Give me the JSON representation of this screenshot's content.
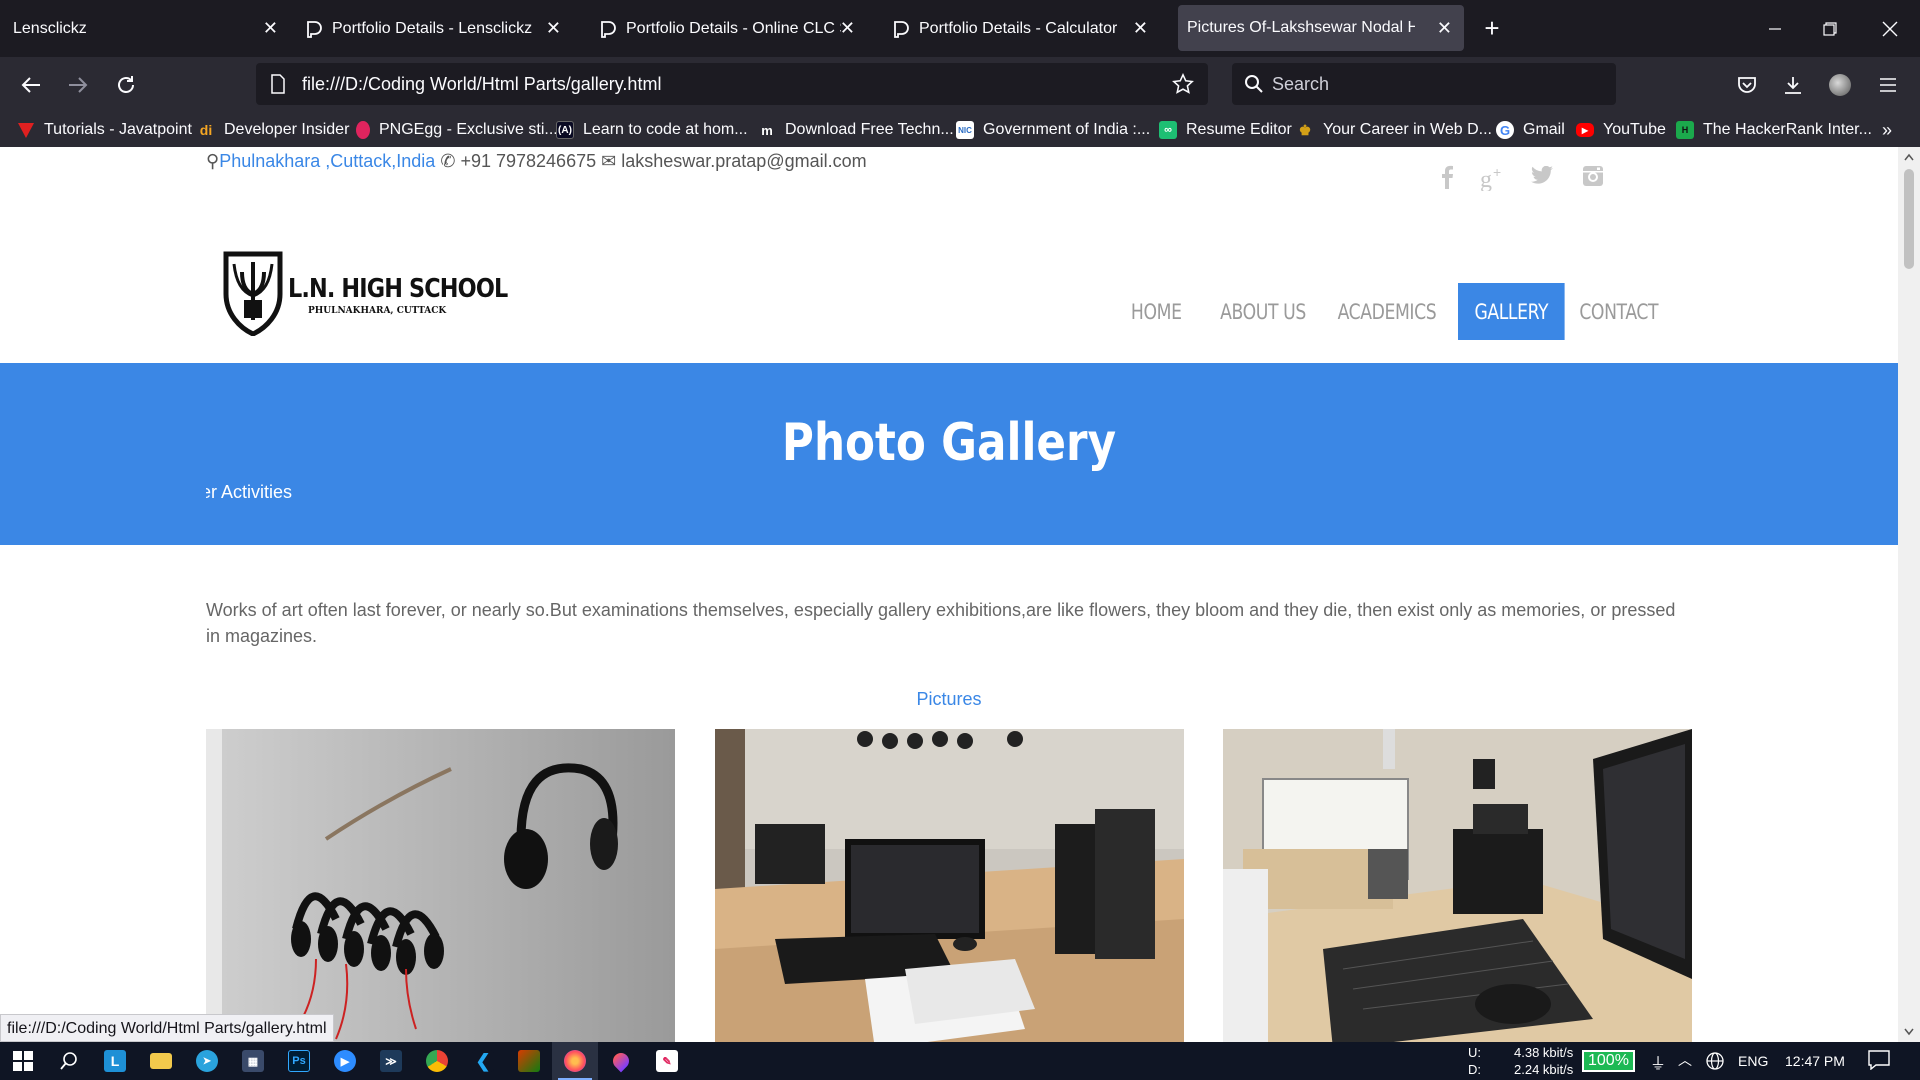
{
  "browser": {
    "tabs": [
      {
        "label": "Lensclickz",
        "active": false
      },
      {
        "label": "Portfolio Details - Lensclickz",
        "active": false
      },
      {
        "label": "Portfolio Details - Online CLC Sys",
        "active": false
      },
      {
        "label": "Portfolio Details - Calculator",
        "active": false
      },
      {
        "label": "Pictures Of-Lakshsewar Nodal High S",
        "active": true
      }
    ],
    "new_tab": "+",
    "url": "file:///D:/Coding World/Html Parts/gallery.html",
    "search_placeholder": "Search",
    "bookmarks": [
      {
        "label": "Tutorials - Javatpoint",
        "icon": "javatpoint-icon",
        "color": "#e02020"
      },
      {
        "label": "Developer Insider",
        "icon": "developer-insider-icon",
        "color": "#f5a623"
      },
      {
        "label": "PNGEgg - Exclusive sti...",
        "icon": "pngegg-icon",
        "color": "#e0245e"
      },
      {
        "label": "Learn to code at hom...",
        "icon": "freecodecamp-icon",
        "color": "#0a0a23"
      },
      {
        "label": "Download Free Techn...",
        "icon": "m-icon",
        "color": "#2b2a33"
      },
      {
        "label": "Government of India :...",
        "icon": "nielit-icon",
        "color": "#2a6cc4"
      },
      {
        "label": "Resume Editor",
        "icon": "resume-editor-icon",
        "color": "#1dbf73"
      },
      {
        "label": "Your Career in Web D...",
        "icon": "career-icon",
        "color": "#d4a017"
      },
      {
        "label": "Gmail",
        "icon": "google-icon",
        "color": "#ffffff"
      },
      {
        "label": "YouTube",
        "icon": "youtube-icon",
        "color": "#ff0000"
      },
      {
        "label": "The HackerRank Inter...",
        "icon": "hackerrank-icon",
        "color": "#111111"
      }
    ]
  },
  "site": {
    "topbar": {
      "location": "Phulnakhara ,Cuttack,India",
      "phone": "+91 7978246675",
      "email": "laksheswar.pratap@gmail.com"
    },
    "logo": {
      "name": "L.N. HIGH SCHOOL",
      "sub": "PHULNAKHARA, CUTTACK"
    },
    "menu": [
      {
        "label": "HOME",
        "active": false
      },
      {
        "label": "ABOUT US",
        "active": false
      },
      {
        "label": "ACADEMICS",
        "active": false
      },
      {
        "label": "GALLERY",
        "active": true
      },
      {
        "label": "CONTACT",
        "active": false
      }
    ],
    "banner": {
      "title": "Photo Gallery",
      "subtitle": "Other Activities"
    },
    "intro": "Works of art often last forever, or nearly so.But examinations themselves, especially gallery exhibitions,are like flowers, they bloom and they die, then exist only as memories, or pressed in magazines.",
    "pictures_label": "Pictures",
    "accent": "#3b87e5"
  },
  "statusbar": {
    "link": "file:///D:/Coding World/Html Parts/gallery.html"
  },
  "taskbar": {
    "net_up_label": "U:",
    "net_down_label": "D:",
    "net_up": "4.38 kbit/s",
    "net_down": "2.24 kbit/s",
    "battery": "100%",
    "language": "ENG",
    "time": "12:47 PM"
  }
}
